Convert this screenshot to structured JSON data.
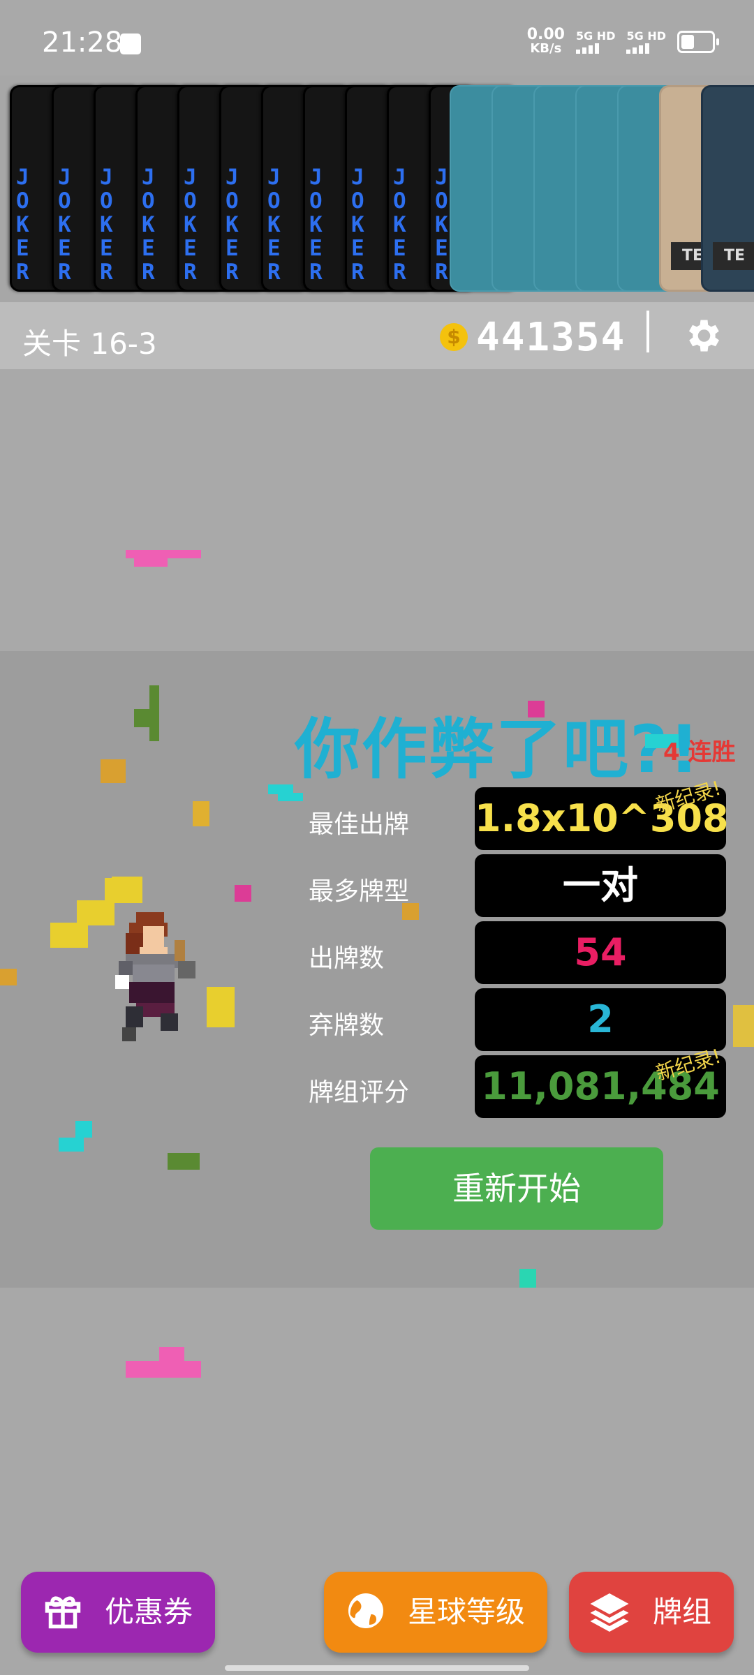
{
  "status": {
    "time": "21:28",
    "net_speed": "0.00",
    "net_unit": "KB/s",
    "sim1": "5G HD",
    "sim2": "5G HD"
  },
  "deck_strip": {
    "joker_text": "J\nO\nK\nE\nR",
    "joker_count": 11,
    "teal_count": 5,
    "tag_text": "TE"
  },
  "header": {
    "level": "关卡 16-3",
    "coin_symbol": "$",
    "money": "441354"
  },
  "result": {
    "title": "你作弊了吧?!",
    "streak": "4 连胜",
    "new_record": "新纪录!",
    "rows": [
      {
        "label": "最佳出牌",
        "value": "1.8x10^308",
        "color": "#f7e04b"
      },
      {
        "label": "最多牌型",
        "value": "一对",
        "color": "#ffffff"
      },
      {
        "label": "出牌数",
        "value": "54",
        "color": "#e91e63"
      },
      {
        "label": "弃牌数",
        "value": "2",
        "color": "#29b6d6"
      },
      {
        "label": "牌组评分",
        "value": "11,081,484",
        "color": "#4a9b3c"
      }
    ],
    "restart": "重新开始"
  },
  "bottom_nav": {
    "coupon": "优惠券",
    "planet": "星球等级",
    "deck": "牌组"
  },
  "colors": {
    "coupon": "#9c27b0",
    "planet": "#f28a11",
    "deck": "#e0433f",
    "restart": "#4caf50",
    "title": "#1fb0d2"
  }
}
